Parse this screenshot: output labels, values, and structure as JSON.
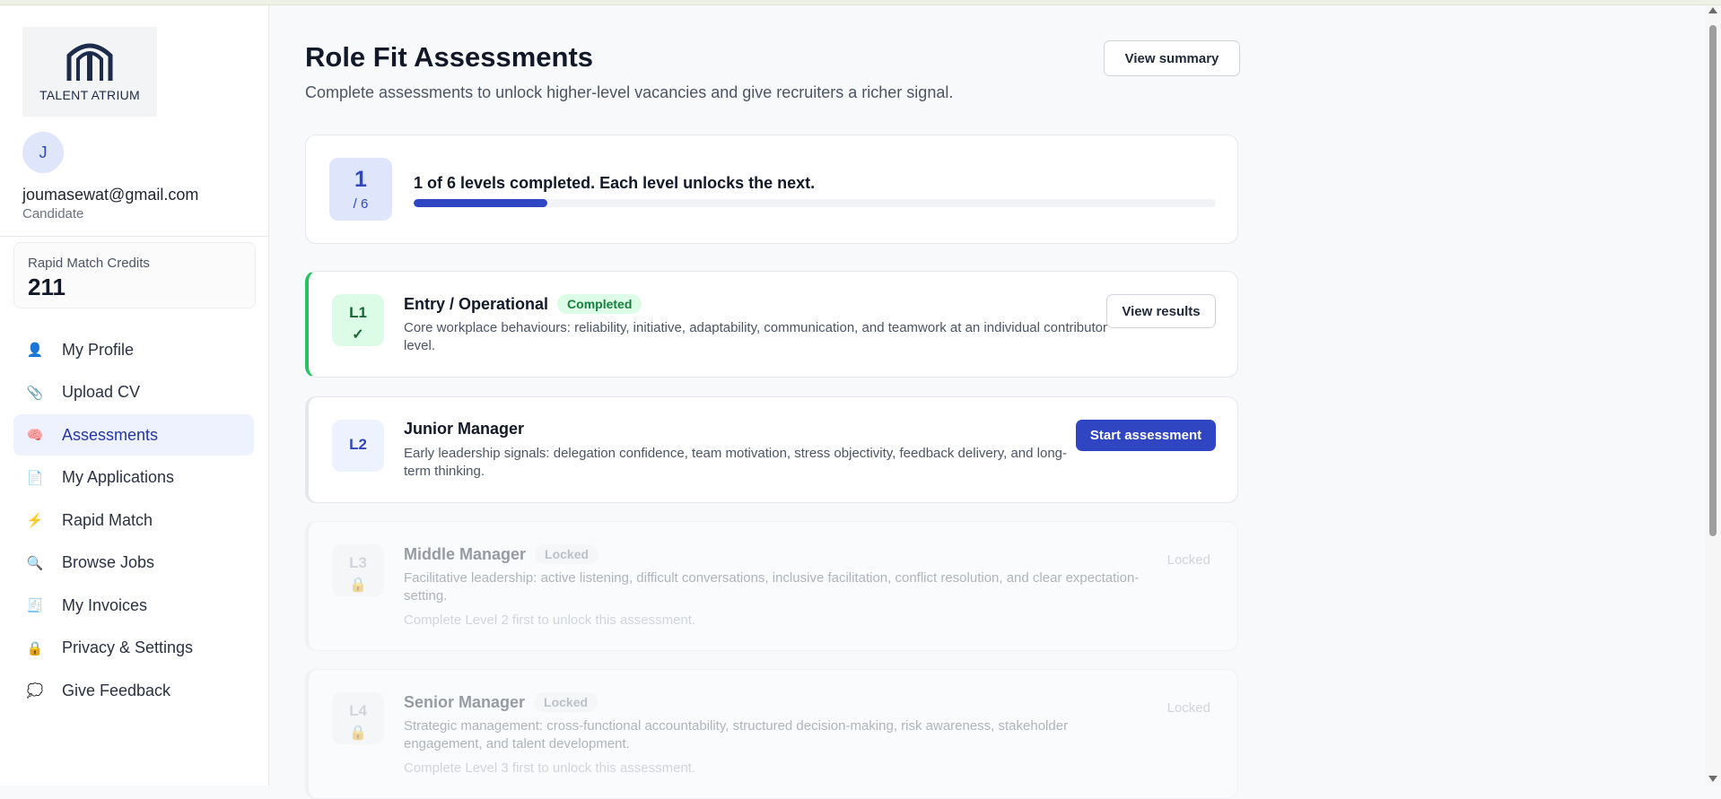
{
  "brand": {
    "name": "TALENT ATRIUM"
  },
  "user": {
    "initial": "J",
    "email": "joumasewat@gmail.com",
    "role": "Candidate"
  },
  "credits": {
    "label": "Rapid Match Credits",
    "value": "211"
  },
  "nav": {
    "items": [
      {
        "label": "My Profile",
        "icon": "person-icon",
        "glyph": "👤"
      },
      {
        "label": "Upload CV",
        "icon": "paperclip-icon",
        "glyph": "📎"
      },
      {
        "label": "Assessments",
        "icon": "brain-icon",
        "glyph": "🧠",
        "active": true
      },
      {
        "label": "My Applications",
        "icon": "document-icon",
        "glyph": "📄"
      },
      {
        "label": "Rapid Match",
        "icon": "lightning-icon",
        "glyph": "⚡"
      },
      {
        "label": "Browse Jobs",
        "icon": "magnifier-icon",
        "glyph": "🔍"
      },
      {
        "label": "My Invoices",
        "icon": "receipt-icon",
        "glyph": "🧾"
      },
      {
        "label": "Privacy & Settings",
        "icon": "lock-icon",
        "glyph": "🔒"
      },
      {
        "label": "Give Feedback",
        "icon": "speech-bubble-icon",
        "glyph": "💭"
      }
    ]
  },
  "header": {
    "title": "Role Fit Assessments",
    "subtitle": "Complete assessments to unlock higher-level vacancies and give recruiters a richer signal.",
    "summary_button": "View summary"
  },
  "progress": {
    "completed": "1",
    "total_label": "/ 6",
    "text": "1 of 6 levels completed. Each level unlocks the next.",
    "fraction": 0.1667
  },
  "levels": [
    {
      "code": "L1",
      "symbol": "✓",
      "name": "Entry / Operational",
      "status": "Completed",
      "description": "Core workplace behaviours: reliability, initiative, adaptability, communication, and teamwork at an individual contributor level.",
      "action": "View results"
    },
    {
      "code": "L2",
      "symbol": "",
      "name": "Junior Manager",
      "status": "",
      "description": "Early leadership signals: delegation confidence, team motivation, stress objectivity, feedback delivery, and long-term thinking.",
      "action": "Start assessment"
    },
    {
      "code": "L3",
      "symbol": "🔒",
      "name": "Middle Manager",
      "status": "Locked",
      "description": "Facilitative leadership: active listening, difficult conversations, inclusive facilitation, conflict resolution, and clear expectation-setting.",
      "hint": "Complete Level 2 first to unlock this assessment.",
      "action": "Locked"
    },
    {
      "code": "L4",
      "symbol": "🔒",
      "name": "Senior Manager",
      "status": "Locked",
      "description": "Strategic management: cross-functional accountability, structured decision-making, risk awareness, stakeholder engagement, and talent development.",
      "hint": "Complete Level 3 first to unlock this assessment.",
      "action": "Locked"
    }
  ],
  "colors": {
    "accent": "#2f45c2",
    "success": "#22c55e",
    "success_bg": "#dcfce7"
  }
}
